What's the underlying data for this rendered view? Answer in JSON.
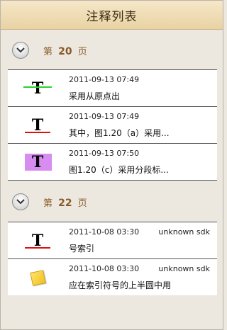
{
  "window": {
    "title": "注释列表"
  },
  "sections": [
    {
      "page_prefix": "第",
      "page_number": "20",
      "page_suffix": "页",
      "items": [
        {
          "icon": "strikeout-green-icon",
          "time": "2011-09-13 07:49",
          "author": "",
          "text": "采用从原点出"
        },
        {
          "icon": "underline-red-icon",
          "time": "2011-09-13 07:49",
          "author": "",
          "text": "其中，图1.20（a）采用..."
        },
        {
          "icon": "highlight-purple-icon",
          "time": "2011-09-13 07:50",
          "author": "",
          "text": "图1.20（c）采用分段标..."
        }
      ]
    },
    {
      "page_prefix": "第",
      "page_number": "22",
      "page_suffix": "页",
      "items": [
        {
          "icon": "underline-red-icon",
          "time": "2011-10-08 03:30",
          "author": "unknown sdk",
          "text": "号索引"
        },
        {
          "icon": "sticky-note-icon",
          "time": "2011-10-08 03:30",
          "author": "unknown sdk",
          "text": "应在索引符号的上半圆中用"
        }
      ]
    }
  ],
  "colors": {
    "strike_green": "#2bd12b",
    "underline_red": "#dd1111",
    "highlight_purple": "#d78cf0",
    "section_label": "#8a5a26"
  }
}
